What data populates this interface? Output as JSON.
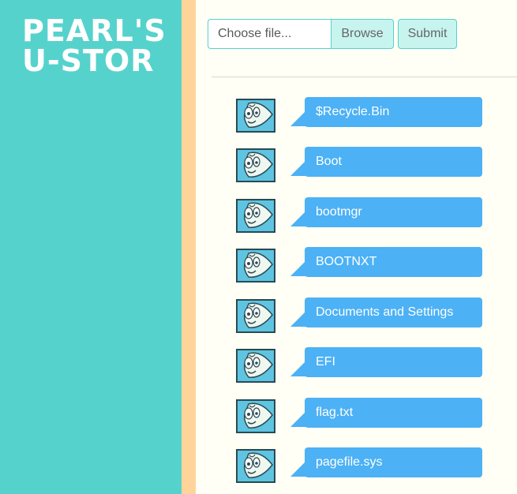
{
  "brand": {
    "line1": "PEARL'S",
    "line2": "U-STOR"
  },
  "upload": {
    "file_placeholder": "Choose file...",
    "browse_label": "Browse",
    "submit_label": "Submit"
  },
  "files": [
    {
      "name": "$Recycle.Bin"
    },
    {
      "name": "Boot"
    },
    {
      "name": "bootmgr"
    },
    {
      "name": "BOOTNXT"
    },
    {
      "name": "Documents and Settings"
    },
    {
      "name": "EFI"
    },
    {
      "name": "flag.txt"
    },
    {
      "name": "pagefile.sys"
    }
  ],
  "colors": {
    "sidebar": "#56d2cc",
    "stripe": "#ffd49a",
    "bubble": "#4cb1f5",
    "page": "#fffff5"
  },
  "icons": {
    "avatar": "pearl-avatar-icon"
  }
}
